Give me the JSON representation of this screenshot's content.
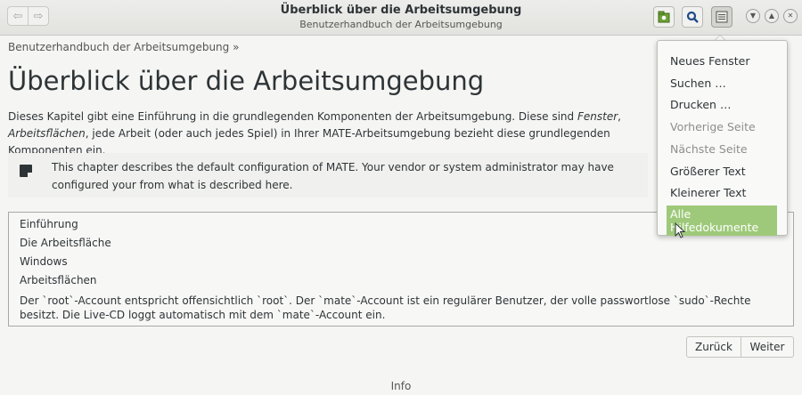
{
  "window": {
    "title": "Überblick über die Arbeitsumgebung",
    "subtitle": "Benutzerhandbuch der Arbeitsumgebung"
  },
  "icons": {
    "back": "back-arrow-icon",
    "forward": "forward-arrow-icon",
    "bookmark": "bookmark-icon",
    "search": "search-icon",
    "menu": "hamburger-menu-icon",
    "minimize": "minimize-icon",
    "maximize": "maximize-icon",
    "close": "close-icon",
    "note": "note-icon"
  },
  "page": {
    "breadcrumb": "Benutzerhandbuch der Arbeitsumgebung »",
    "heading": "Überblick über die Arbeitsumgebung",
    "intro_part1": "Dieses Kapitel gibt eine Einführung in die grundlegenden Komponenten der Arbeitsumgebung. Diese sind ",
    "intro_em1": "Fenster",
    "intro_sep": ", ",
    "intro_em2": "Arbeitsflächen",
    "intro_part2": ", jede Arbeit (oder auch jedes Spiel) in Ihrer MATE-Arbeitsumgebung bezieht diese grundlegenden Komponenten ein.",
    "note_text": "This chapter describes the default configuration of MATE. Your vendor or system administrator may have configured your from what is described here.",
    "toc": [
      "Einführung",
      "Die Arbeitsfläche",
      "Windows",
      "Arbeitsflächen"
    ],
    "toc_desc": "Der `root`-Account entspricht offensichtlich `root`. Der `mate`-Account ist ein regulärer Benutzer, der volle passwortlose `sudo`-Rechte besitzt. Die Live-CD loggt automatisch mit dem `mate`-Account ein.",
    "prev_label": "Zurück",
    "next_label": "Weiter",
    "footer": "Info"
  },
  "menu": {
    "items": [
      {
        "label": "Neues Fenster",
        "state": "normal"
      },
      {
        "label": "Suchen …",
        "state": "normal"
      },
      {
        "label": "Drucken …",
        "state": "normal"
      },
      {
        "label": "Vorherige Seite",
        "state": "disabled"
      },
      {
        "label": "Nächste Seite",
        "state": "disabled"
      },
      {
        "label": "Größerer Text",
        "state": "normal"
      },
      {
        "label": "Kleinerer Text",
        "state": "normal"
      },
      {
        "label": "Alle Hilfedokumente",
        "state": "highlighted"
      }
    ]
  },
  "colors": {
    "highlight": "#9ec97a",
    "bookmark_icon": "#4e9a06",
    "search_icon": "#204a87"
  }
}
